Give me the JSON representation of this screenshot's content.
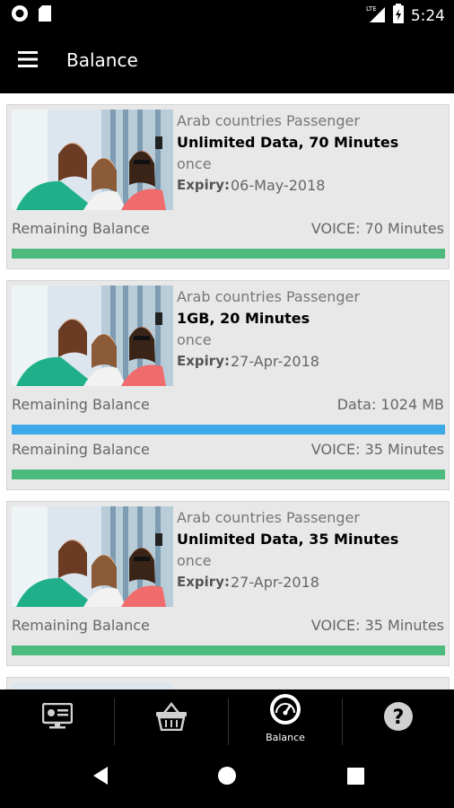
{
  "status_bar": {
    "time": "5:24",
    "network": "LTE"
  },
  "app_bar": {
    "title": "Balance"
  },
  "cards": [
    {
      "package_type": "Arab countries Passenger",
      "package_name": "Unlimited Data, 70 Minutes",
      "frequency": "once",
      "expiry_label": "Expiry:",
      "expiry_date": "06-May-2018",
      "balances": [
        {
          "label": "Remaining Balance",
          "value": "VOICE: 70 Minutes",
          "color": "#4cbb7d"
        }
      ]
    },
    {
      "package_type": "Arab countries Passenger",
      "package_name": "1GB, 20 Minutes",
      "frequency": "once",
      "expiry_label": "Expiry:",
      "expiry_date": "27-Apr-2018",
      "balances": [
        {
          "label": "Remaining Balance",
          "value": "Data: 1024 MB",
          "color": "#3ca9e8"
        },
        {
          "label": "Remaining Balance",
          "value": "VOICE: 35 Minutes",
          "color": "#4cbb7d"
        }
      ]
    },
    {
      "package_type": "Arab countries Passenger",
      "package_name": "Unlimited Data, 35 Minutes",
      "frequency": "once",
      "expiry_label": "Expiry:",
      "expiry_date": "27-Apr-2018",
      "balances": [
        {
          "label": "Remaining Balance",
          "value": "VOICE: 35 Minutes",
          "color": "#4cbb7d"
        }
      ]
    }
  ],
  "bottom_nav": {
    "items": [
      {
        "icon": "dashboard-icon",
        "label": ""
      },
      {
        "icon": "basket-icon",
        "label": ""
      },
      {
        "icon": "speedometer-icon",
        "label": "Balance",
        "active": true
      },
      {
        "icon": "help-icon",
        "label": ""
      }
    ]
  },
  "colors": {
    "voice_bar": "#4cbb7d",
    "data_bar": "#3ca9e8",
    "card_bg": "#e8e8e8"
  }
}
